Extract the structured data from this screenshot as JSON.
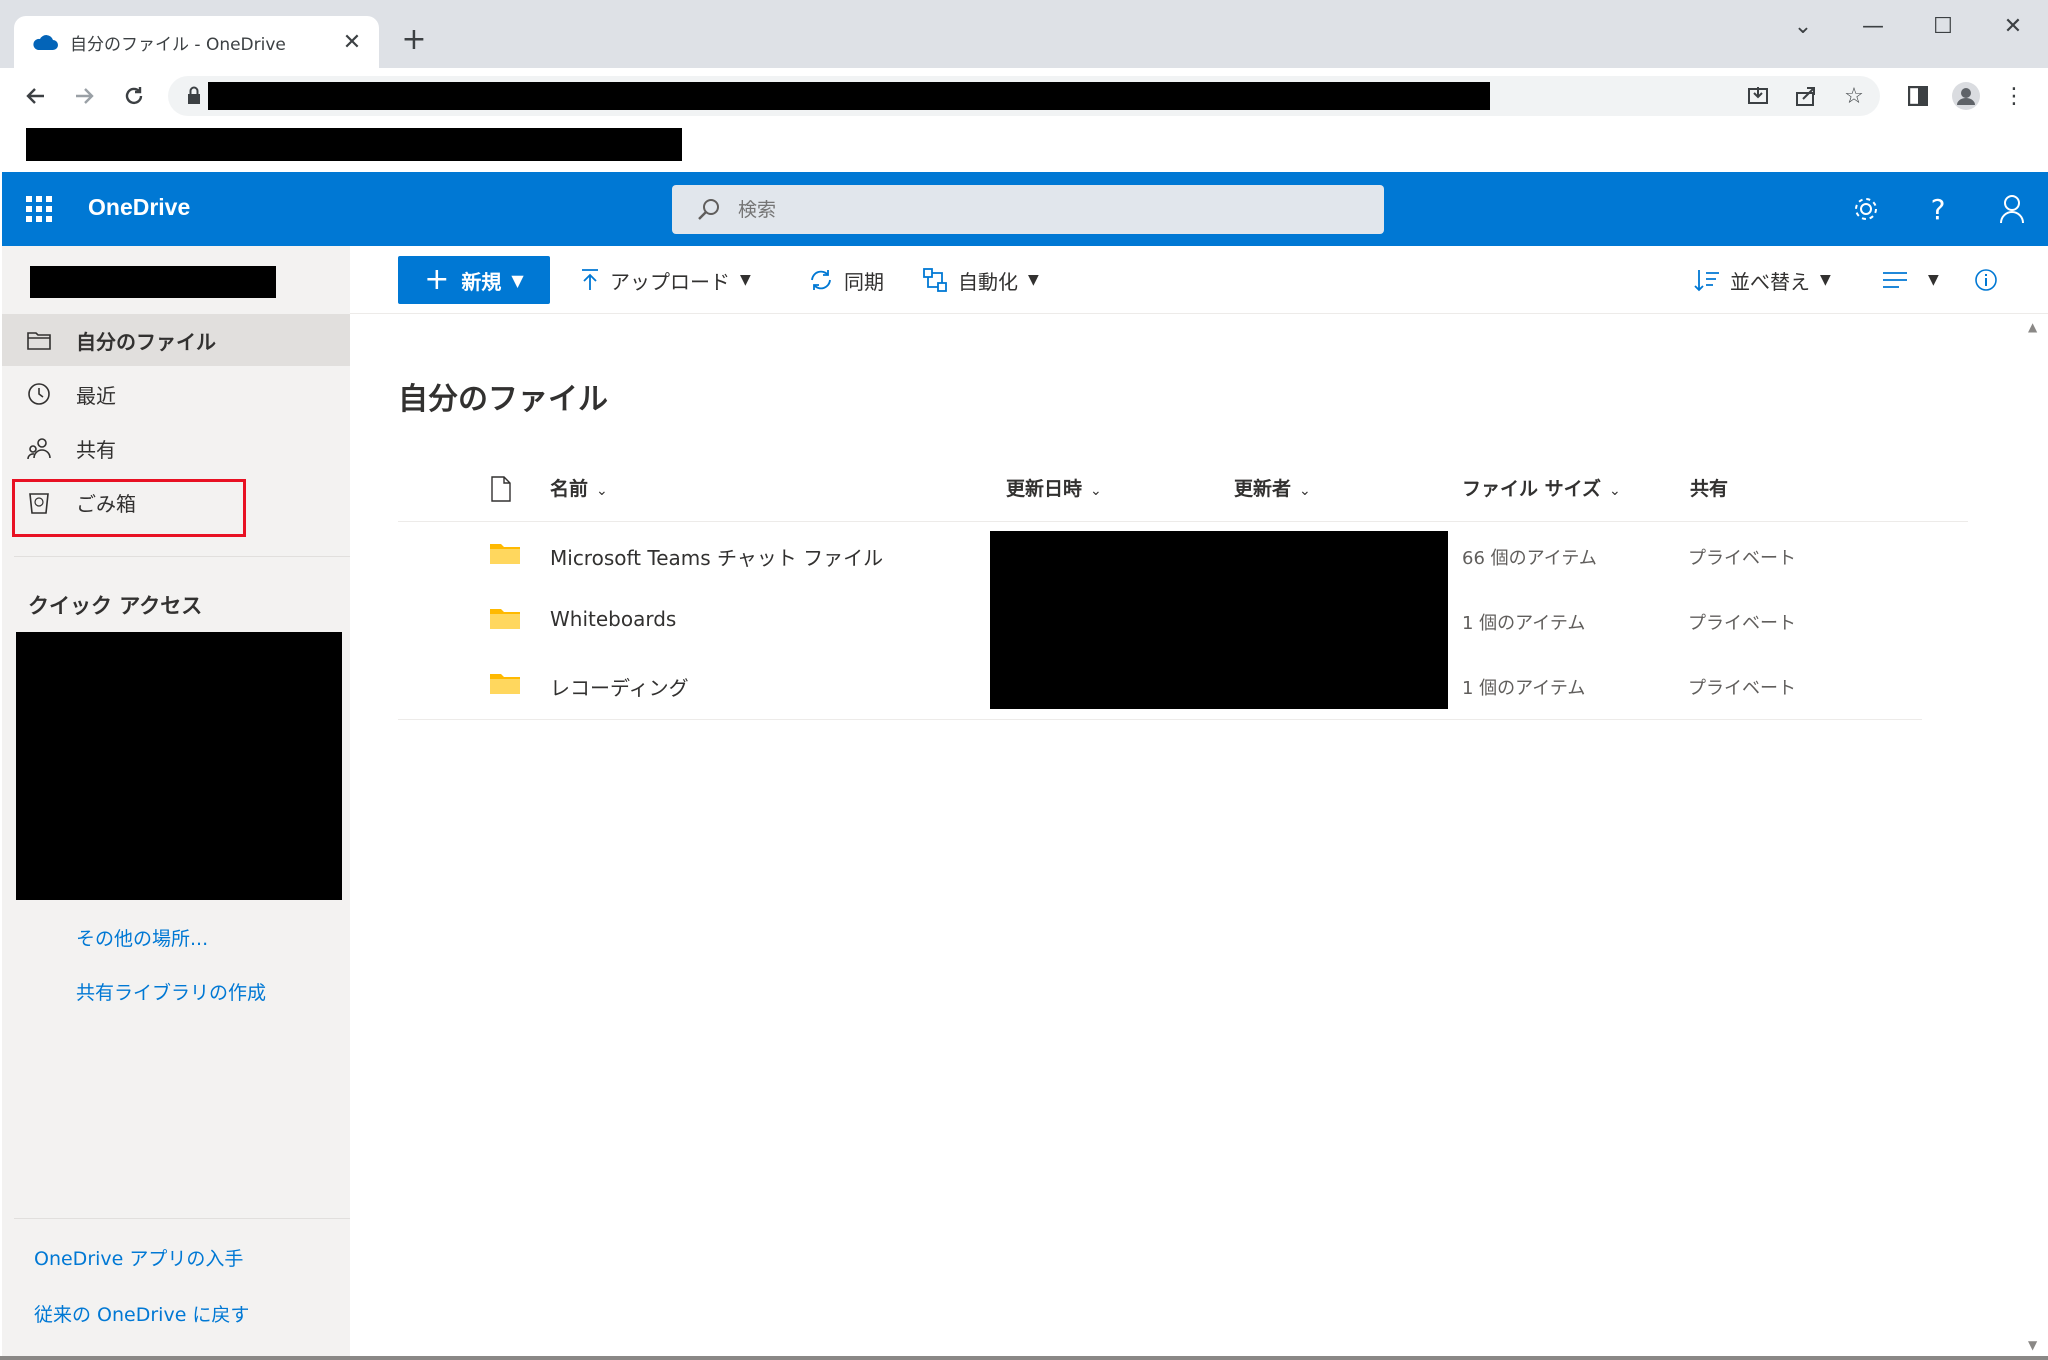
{
  "browser": {
    "tab_title": "自分のファイル - OneDrive",
    "tab_close": "✕",
    "new_tab": "+",
    "window_controls": [
      "⌄",
      "—",
      "☐",
      "✕"
    ]
  },
  "header": {
    "app_name": "OneDrive",
    "search_placeholder": "検索",
    "accent": "#0078d4"
  },
  "sidebar": {
    "items": [
      {
        "label": "自分のファイル",
        "icon": "folder-icon",
        "selected": true
      },
      {
        "label": "最近",
        "icon": "clock-icon",
        "selected": false
      },
      {
        "label": "共有",
        "icon": "people-icon",
        "selected": false
      },
      {
        "label": "ごみ箱",
        "icon": "recycle-bin-icon",
        "selected": false
      }
    ],
    "quick_access_title": "クイック アクセス",
    "more_places": "その他の場所...",
    "create_library": "共有ライブラリの作成",
    "get_app": "OneDrive アプリの入手",
    "classic": "従来の OneDrive に戻す"
  },
  "commandbar": {
    "new_label": "新規",
    "upload_label": "アップロード",
    "sync_label": "同期",
    "automate_label": "自動化",
    "sort_label": "並べ替え"
  },
  "main": {
    "page_title": "自分のファイル",
    "columns": {
      "name": "名前",
      "modified": "更新日時",
      "modified_by": "更新者",
      "file_size": "ファイル サイズ",
      "sharing": "共有"
    },
    "rows": [
      {
        "name": "Microsoft Teams チャット ファイル",
        "size": "66 個のアイテム",
        "sharing": "プライベート"
      },
      {
        "name": "Whiteboards",
        "size": "1 個のアイテム",
        "sharing": "プライベート"
      },
      {
        "name": "レコーディング",
        "size": "1 個のアイテム",
        "sharing": "プライベート"
      }
    ]
  }
}
